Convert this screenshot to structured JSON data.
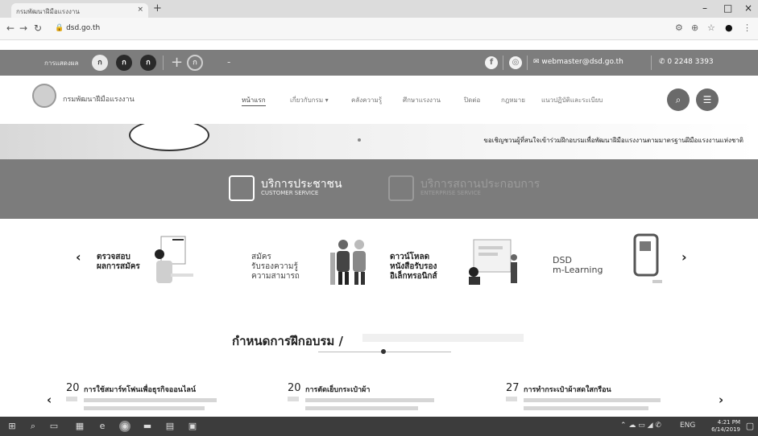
{
  "browser": {
    "tab_title": "กรมพัฒนาฝีมือแรงงาน",
    "tab_close": "×",
    "new_tab": "+",
    "url": "dsd.go.th",
    "win_min": "–",
    "win_max": "□",
    "win_close": "×"
  },
  "utility": {
    "label": "การแสดงผล",
    "font_buttons": [
      "ก",
      "ก",
      "ก"
    ],
    "zoom_plus": "+",
    "zoom_normal": "ก",
    "zoom_minus": "-",
    "email": "webmaster@dsd.go.th",
    "phone": "0 2248 3393"
  },
  "header": {
    "site_name": "กรมพัฒนาฝีมือแรงงาน",
    "menu": [
      "หน้าแรก",
      "เกี่ยวกับกรม ▾",
      "คลังความรู้",
      "ศึกษาแรงงาน",
      "ปิดต่อ",
      "กฎหมาย",
      "แนวปฏิบัติและระเบียบ"
    ]
  },
  "announcement": {
    "ticker": "ขอเชิญชวนผู้ที่สนใจเข้าร่วมฝึกอบรมเพื่อพัฒนาฝีมือแรงงานตามมาตรฐานฝีมือแรงงานแห่งชาติ"
  },
  "services": [
    {
      "title": "บริการประชาชน",
      "subtitle": "CUSTOMER SERVICE"
    },
    {
      "title": "บริการสถานประกอบการ",
      "subtitle": "ENTERPRISE SERVICE"
    }
  ],
  "carousel": {
    "prev": "‹",
    "next": "›",
    "cards": [
      {
        "title": "ตรวจสอบ\nผลการสมัคร"
      },
      {
        "title": "สมัคร\nรับรองความรู้\nความสามารถ"
      },
      {
        "title": "ดาวน์โหลด\nหนังสือรับรอง\nอิเล็กทรอนิกส์"
      },
      {
        "title": "DSD\nm-Learning"
      }
    ]
  },
  "training": {
    "heading": "กำหนดการฝึกอบรม /",
    "prev": "‹",
    "next": "›",
    "items": [
      {
        "day": "20",
        "title": "การใช้สมาร์ทโฟนเพื่อธุรกิจออนไลน์"
      },
      {
        "day": "20",
        "title": "การตัดเย็บกระเป๋าผ้า"
      },
      {
        "day": "27",
        "title": "การทำกระเป๋าผ้าสดใสกรือน"
      }
    ]
  },
  "taskbar": {
    "lang": "ENG",
    "time": "4:21 PM",
    "date": "6/14/2019"
  }
}
